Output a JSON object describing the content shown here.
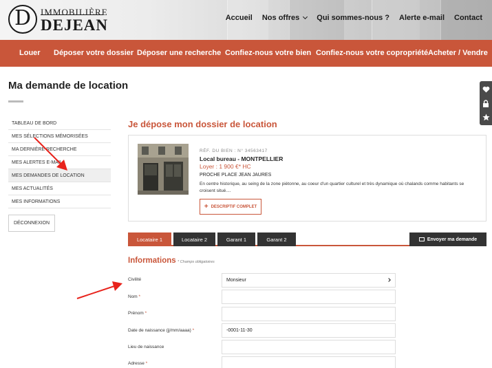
{
  "logo": {
    "letter": "D",
    "line1": "IMMOBILIÈRE",
    "line2": "DEJEAN"
  },
  "topnav": [
    {
      "label": "Accueil"
    },
    {
      "label": "Nos offres"
    },
    {
      "label": "Qui sommes-nous ?"
    },
    {
      "label": "Alerte e-mail"
    },
    {
      "label": "Contact"
    }
  ],
  "mainnav": [
    {
      "label": "Louer"
    },
    {
      "label": "Déposer votre dossier"
    },
    {
      "label": "Déposer une recherche"
    },
    {
      "label": "Confiez-nous votre bien"
    },
    {
      "label": "Confiez-nous votre copropriété"
    },
    {
      "label": "Acheter / Vendre"
    }
  ],
  "page_title": "Ma demande de location",
  "sidemenu": [
    {
      "label": "TABLEAU DE BORD"
    },
    {
      "label": "MES SÉLECTIONS MÉMORISÉES"
    },
    {
      "label": "MA DERNIÈRE RECHERCHE"
    },
    {
      "label": "MES ALERTES E-MAIL"
    },
    {
      "label": "MES DEMANDES DE LOCATION"
    },
    {
      "label": "MES ACTUALITÉS"
    },
    {
      "label": "MES INFORMATIONS"
    }
  ],
  "logout_label": "DÉCONNEXION",
  "main_heading": "Je dépose mon dossier de location",
  "property": {
    "ref": "RÉF. DU BIEN : N° 34563417",
    "name": "Local bureau - MONTPELLIER",
    "rent": "Loyer : 1 900 €* HC",
    "address": "PROCHE PLACE JEAN JAURES",
    "description": "En centre historique, au seing de la zone piétonne, au coeur d'un quartier culturel et très dynamique où chalands comme habitants se croisent situé....",
    "desc_button": "DESCRIPTIF COMPLET"
  },
  "tabs": [
    {
      "label": "Locataire 1"
    },
    {
      "label": "Locataire 2"
    },
    {
      "label": "Garant 1"
    },
    {
      "label": "Garant 2"
    }
  ],
  "send_button": "Envoyer ma demande",
  "info_heading": "Informations",
  "info_required": "* Champs obligatoires",
  "fields": [
    {
      "label": "Civilité",
      "required": "",
      "value": "Monsieur"
    },
    {
      "label": "Nom",
      "required": "*",
      "value": ""
    },
    {
      "label": "Prénom",
      "required": "*",
      "value": ""
    },
    {
      "label": "Date de naissance (jj/mm/aaaa)",
      "required": "*",
      "value": "-0001-11-30"
    },
    {
      "label": "Lieu de naissance",
      "required": "",
      "value": ""
    },
    {
      "label": "Adresse",
      "required": "*",
      "value": ""
    }
  ],
  "floatbar_icons": [
    "heart-icon",
    "lock-icon",
    "star-icon"
  ],
  "colors": {
    "brand_orange": "#c9563a",
    "dark": "#333333",
    "annotation_red": "#e8231c"
  }
}
